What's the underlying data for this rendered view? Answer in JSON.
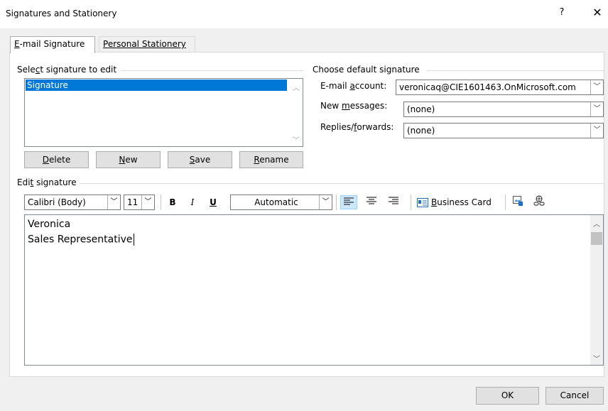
{
  "window": {
    "title": "Signatures and Stationery",
    "help_glyph": "?",
    "close_glyph": "✕"
  },
  "tabs": [
    {
      "label_ul": "E",
      "label_rest": "-mail Signature"
    },
    {
      "label_ul": "P",
      "label_rest": "ersonal Stationery"
    }
  ],
  "select_signature": {
    "label_pre": "Sele",
    "label_ul": "c",
    "label_post": "t signature to edit",
    "items": [
      "Signature"
    ]
  },
  "buttons": {
    "delete": {
      "ul": "D",
      "rest": "elete"
    },
    "new": {
      "ul": "N",
      "rest": "ew"
    },
    "save": {
      "ul": "S",
      "rest": "ave"
    },
    "rename": {
      "ul": "R",
      "rest": "ename"
    }
  },
  "default_signature": {
    "group_label": "Choose default signature",
    "email_account_label_pre": "E-mail ",
    "email_account_label_ul": "a",
    "email_account_label_post": "ccount:",
    "email_account_value": "veronicaq@CIE1601463.OnMicrosoft.com",
    "new_messages_label_pre": "New ",
    "new_messages_label_ul": "m",
    "new_messages_label_post": "essages:",
    "new_messages_value": "(none)",
    "replies_label_pre": "Replies/",
    "replies_label_ul": "f",
    "replies_label_post": "orwards:",
    "replies_value": "(none)"
  },
  "edit_signature": {
    "label_pre": "Edi",
    "label_ul": "t",
    "label_post": " signature",
    "font": "Calibri (Body)",
    "size": "11",
    "bold": "B",
    "italic": "I",
    "underline": "U",
    "color": "Automatic",
    "business_card_ul": "B",
    "business_card_rest": "usiness Card",
    "lines": [
      "Veronica",
      "Sales Representative"
    ]
  },
  "footer": {
    "ok": "OK",
    "cancel": "Cancel"
  },
  "colors": {
    "selection": "#0078d7",
    "accent_active": "#cce8ff"
  }
}
